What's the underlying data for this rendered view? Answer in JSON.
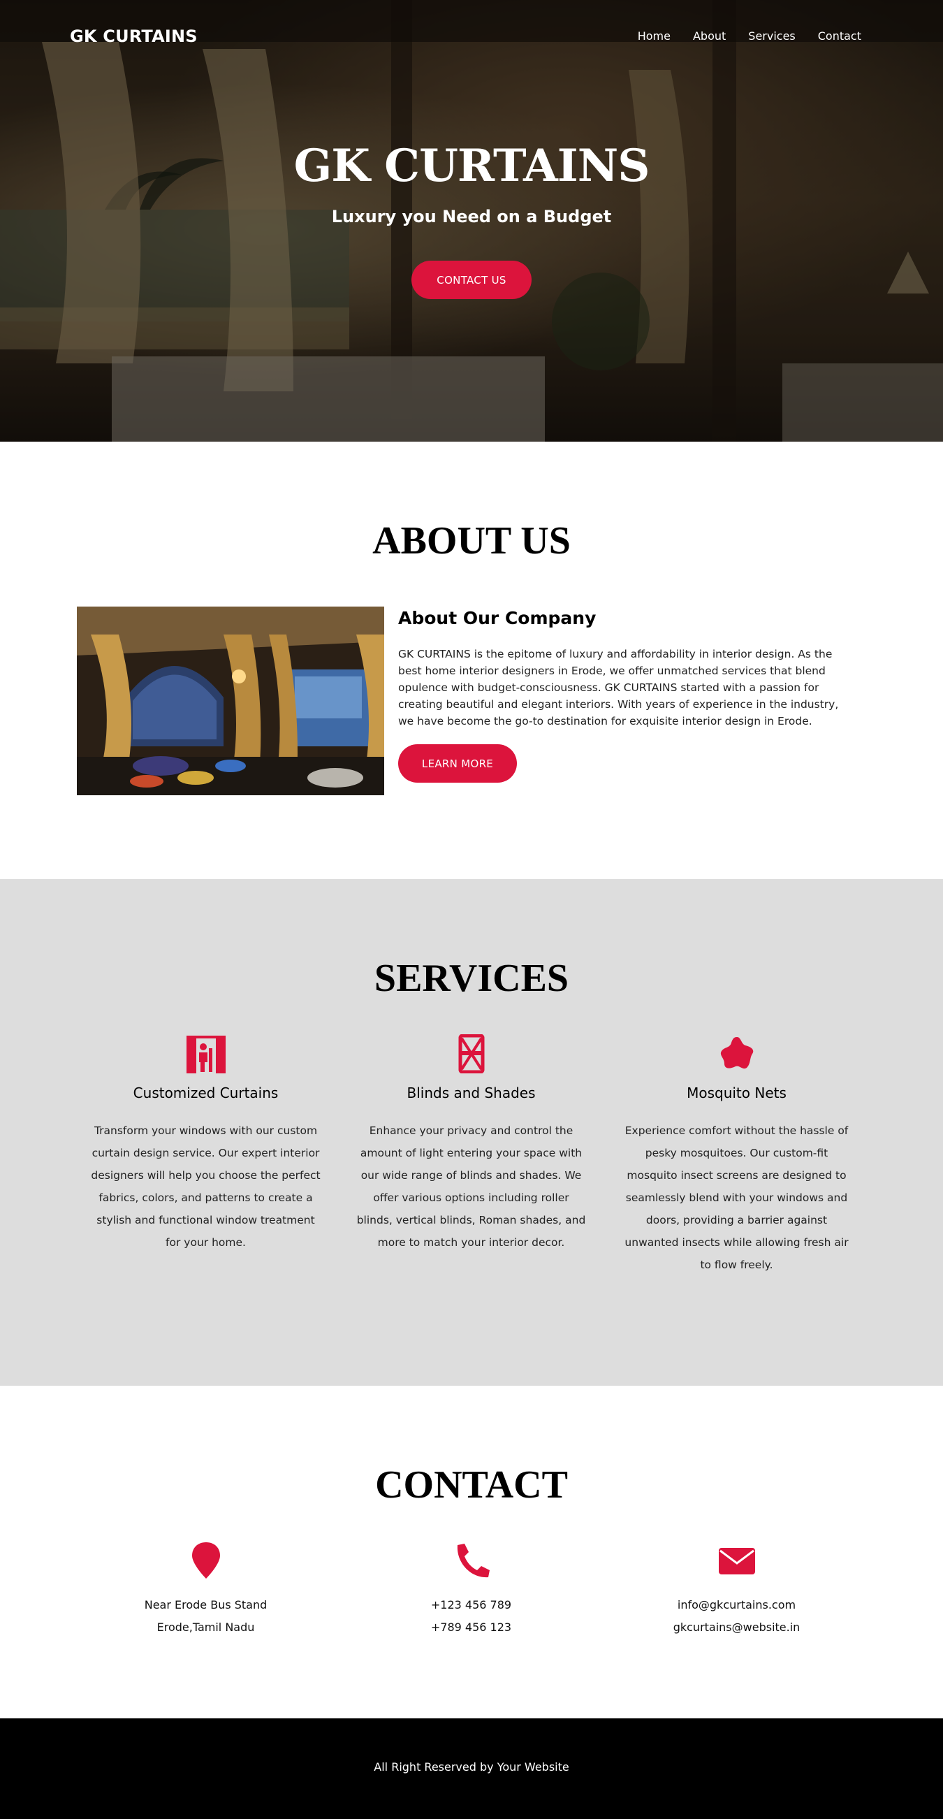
{
  "header": {
    "brand": "GK CURTAINS",
    "nav": [
      "Home",
      "About",
      "Services",
      "Contact"
    ]
  },
  "hero": {
    "title": "GK CURTAINS",
    "subtitle": "Luxury you Need on a Budget",
    "cta": "CONTACT US"
  },
  "about": {
    "title": "ABOUT US",
    "heading": "About Our Company",
    "text": "GK CURTAINS is the epitome of luxury and affordability in interior design. As the best home interior designers in Erode, we offer unmatched services that blend opulence with budget-consciousness. GK CURTAINS started with a passion for creating beautiful and elegant interiors. With years of experience in the industry, we have become the go-to destination for exquisite interior design in Erode.",
    "button": "LEARN MORE"
  },
  "services": {
    "title": "SERVICES",
    "items": [
      {
        "icon": "curtains-icon",
        "title": "Customized Curtains",
        "text": "Transform your windows with our custom curtain design service. Our expert interior designers will help you choose the perfect fabrics, colors, and patterns to create a stylish and functional window treatment for your home."
      },
      {
        "icon": "blinds-icon",
        "title": "Blinds and Shades",
        "text": "Enhance your privacy and control the amount of light entering your space with our wide range of blinds and shades. We offer various options including roller blinds, vertical blinds, Roman shades, and more to match your interior decor."
      },
      {
        "icon": "mosquito-net-icon",
        "title": "Mosquito Nets",
        "text": "Experience comfort without the hassle of pesky mosquitoes. Our custom-fit mosquito insect screens are designed to seamlessly blend with your windows and doors, providing a barrier against unwanted insects while allowing fresh air to flow freely."
      }
    ]
  },
  "contact": {
    "title": "CONTACT",
    "items": [
      {
        "icon": "location-pin-icon",
        "lines": [
          "Near Erode Bus Stand",
          "Erode,Tamil Nadu"
        ]
      },
      {
        "icon": "phone-icon",
        "lines": [
          "+123 456 789",
          "+789 456 123"
        ]
      },
      {
        "icon": "envelope-icon",
        "lines": [
          "info@gkcurtains.com",
          "gkcurtains@website.in"
        ]
      }
    ]
  },
  "footer": {
    "text": "All Right Reserved by Your Website"
  },
  "colors": {
    "accent": "#dc143c",
    "services_bg": "#dddddd",
    "footer_bg": "#000000"
  }
}
